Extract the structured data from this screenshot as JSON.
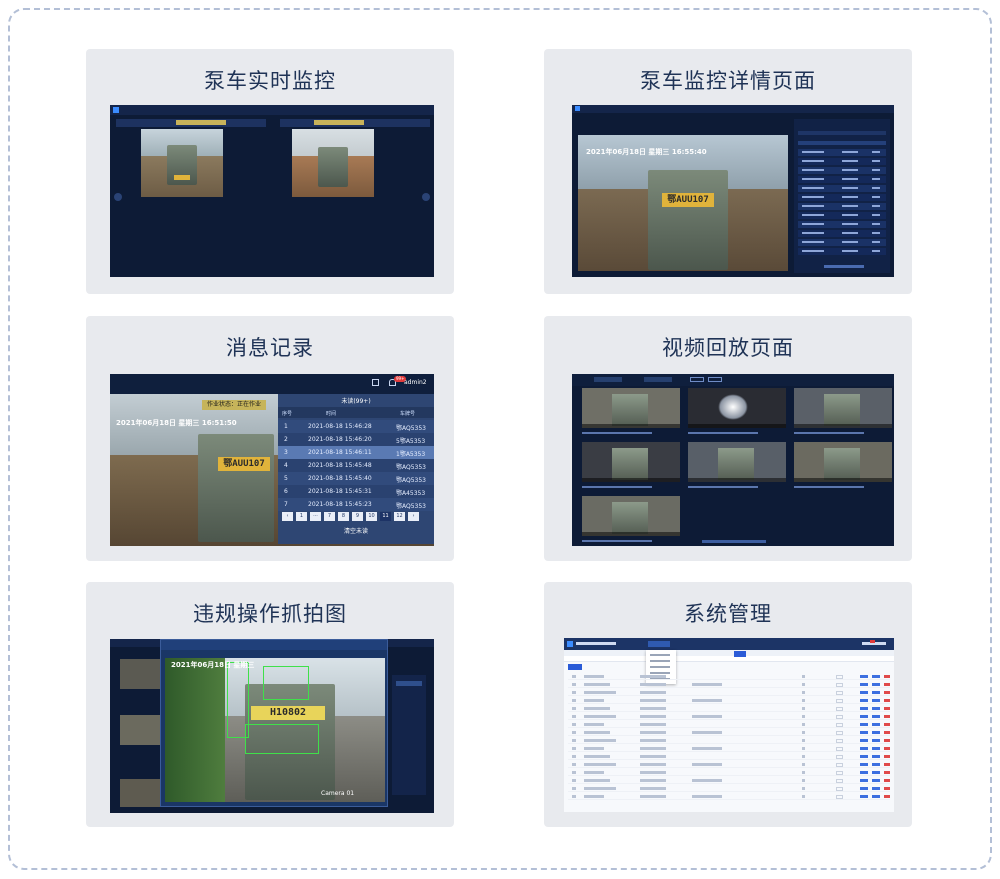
{
  "cards": [
    {
      "id": "pump-monitor",
      "title": "泵车实时监控"
    },
    {
      "id": "pump-detail",
      "title": "泵车监控详情页面"
    },
    {
      "id": "message-log",
      "title": "消息记录"
    },
    {
      "id": "playback",
      "title": "视频回放页面"
    },
    {
      "id": "violation",
      "title": "违规操作抓拍图"
    },
    {
      "id": "system",
      "title": "系统管理"
    }
  ],
  "detail": {
    "overlay_time": "2021年06月18日  星期三  16:55:40",
    "plate": "鄂AUU107"
  },
  "message": {
    "status": "作业状态：正在作业",
    "overlay_time": "2021年06月18日  星期三  16:51:50",
    "plate": "鄂AUU107",
    "badge": "99+",
    "user": "admin2",
    "panel_title": "未读(99+)",
    "headers": [
      "序号",
      "时间",
      "车牌号"
    ],
    "rows": [
      {
        "no": "1",
        "time": "2021-08-18 15:46:28",
        "plate": "鄂AQ5353"
      },
      {
        "no": "2",
        "time": "2021-08-18 15:46:20",
        "plate": "5鄂A5353"
      },
      {
        "no": "3",
        "time": "2021-08-18 15:46:11",
        "plate": "1鄂A5353"
      },
      {
        "no": "4",
        "time": "2021-08-18 15:45:48",
        "plate": "鄂AQ5353"
      },
      {
        "no": "5",
        "time": "2021-08-18 15:45:40",
        "plate": "鄂AQ5353"
      },
      {
        "no": "6",
        "time": "2021-08-18 15:45:31",
        "plate": "鄂A45353"
      },
      {
        "no": "7",
        "time": "2021-08-18 15:45:23",
        "plate": "鄂AQ5353"
      }
    ],
    "pager": [
      "‹",
      "1",
      "···",
      "7",
      "8",
      "9",
      "10",
      "11",
      "12",
      "›"
    ],
    "pager_active": "11",
    "clear": "清空未读"
  },
  "violation": {
    "overlay_time": "2021年06月18日  星期三",
    "plate": "H10802",
    "camera": "Camera 01"
  },
  "colors": {
    "frame_border": "#b3bfd6",
    "card_bg": "#e8eaee",
    "title": "#1f3356",
    "dark_ui": "#0d1b36"
  }
}
